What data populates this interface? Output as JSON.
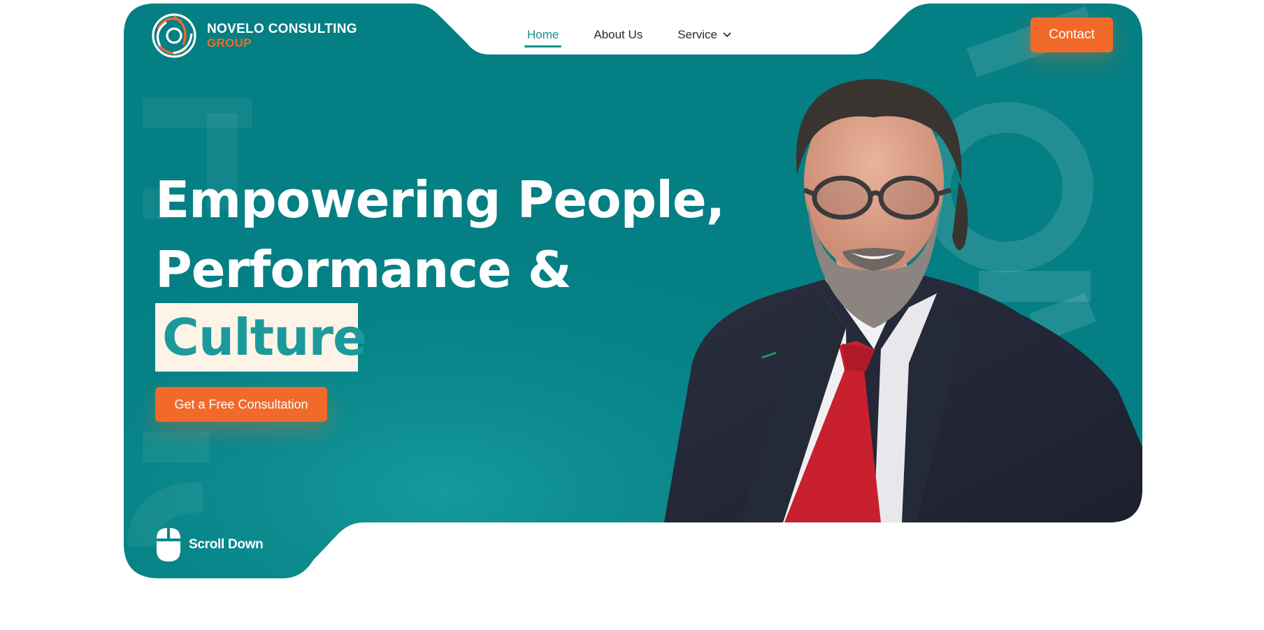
{
  "brand": {
    "name_line1": "NOVELO CONSULTING",
    "name_line2": "GROUP",
    "logo_icon": "interlocking-rings-icon"
  },
  "nav": {
    "items": [
      {
        "label": "Home",
        "active": true
      },
      {
        "label": "About Us",
        "active": false
      },
      {
        "label": "Service",
        "active": false,
        "has_dropdown": true
      }
    ]
  },
  "header": {
    "contact_label": "Contact"
  },
  "hero": {
    "headline_line1": "Empowering People,",
    "headline_line2": "Performance &",
    "headline_highlight": "Culture",
    "cta_label": "Get a Free Consultation",
    "scroll_label": "Scroll Down",
    "scroll_icon": "mouse-icon",
    "image": "portrait-of-smiling-man-in-suit-and-red-tie"
  },
  "colors": {
    "teal": "#047f84",
    "teal_light": "#1c9a9b",
    "orange": "#f26a2a",
    "cream": "#fdf3e7"
  }
}
